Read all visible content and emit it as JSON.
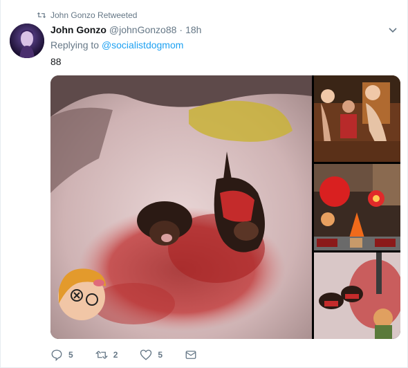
{
  "retweet_banner": {
    "text": "John Gonzo Retweeted"
  },
  "author": {
    "name": "John Gonzo",
    "handle": "@johnGonzo88",
    "separator": "·",
    "time": "18h"
  },
  "reply": {
    "prefix": "Replying to",
    "mention": "@socialistdogmom"
  },
  "tweet": {
    "text": "88"
  },
  "media": {
    "main": "photo-edit-dachshunds",
    "side": [
      "photo-edit-group",
      "doom-screenshot-edit",
      "photo-edit-dachshunds-game"
    ]
  },
  "actions": {
    "reply_count": "5",
    "retweet_count": "2",
    "like_count": "5"
  },
  "colors": {
    "accent": "#1da1f2",
    "secondary_text": "#657786",
    "primary_text": "#14171a",
    "border": "#e6ecf0"
  },
  "icons": [
    "retweet-icon",
    "chevron-down-icon",
    "reply-icon",
    "retweet-icon",
    "heart-icon",
    "message-icon"
  ]
}
